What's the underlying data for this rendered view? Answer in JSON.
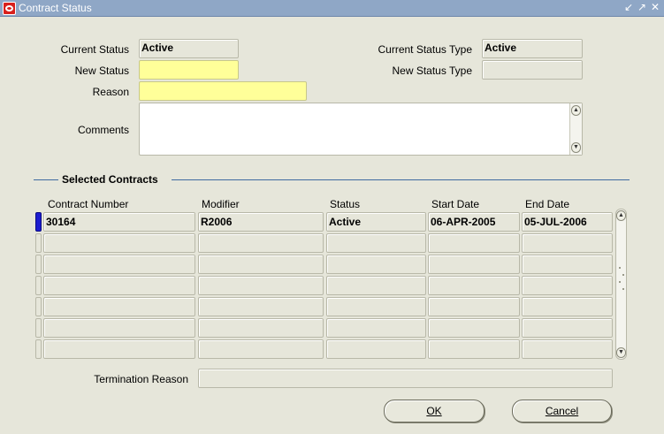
{
  "window": {
    "title": "Contract Status"
  },
  "header": {
    "current_status_label": "Current Status",
    "current_status_value": "Active",
    "current_status_type_label": "Current Status Type",
    "current_status_type_value": "Active",
    "new_status_label": "New Status",
    "new_status_value": "",
    "new_status_type_label": "New Status Type",
    "new_status_type_value": "",
    "reason_label": "Reason",
    "reason_value": "",
    "comments_label": "Comments",
    "comments_value": ""
  },
  "selected_contracts": {
    "title": "Selected Contracts",
    "columns": [
      "Contract Number",
      "Modifier",
      "Status",
      "Start Date",
      "End Date"
    ],
    "rows": [
      [
        "30164",
        "R2006",
        "Active",
        "06-APR-2005",
        "05-JUL-2006"
      ],
      [
        "",
        "",
        "",
        "",
        ""
      ],
      [
        "",
        "",
        "",
        "",
        ""
      ],
      [
        "",
        "",
        "",
        "",
        ""
      ],
      [
        "",
        "",
        "",
        "",
        ""
      ],
      [
        "",
        "",
        "",
        "",
        ""
      ],
      [
        "",
        "",
        "",
        "",
        ""
      ]
    ]
  },
  "termination": {
    "label": "Termination Reason",
    "value": ""
  },
  "buttons": {
    "ok": "OK",
    "cancel": "Cancel"
  },
  "colors": {
    "titlebar": "#8fa7c6",
    "required": "#ffff99",
    "background": "#e6e6da",
    "section_line": "#3f6aa0"
  }
}
